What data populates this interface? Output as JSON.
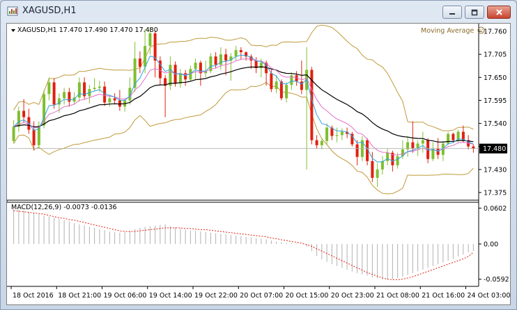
{
  "window": {
    "title": "XAGUSD,H1",
    "icon": "chart-window-icon",
    "controls": [
      "minimize-icon",
      "maximize-icon",
      "close-icon"
    ]
  },
  "chart_header": {
    "symbol": "XAGUSD,H1",
    "ohlc": "17.470 17.490 17.470 17.480",
    "indicator": "Moving Average"
  },
  "macd_header": {
    "label": "MACD(12,26,9)",
    "values": "-0.0073 -0.0136"
  },
  "price_axis": {
    "ticks": [
      "17.760",
      "17.705",
      "17.650",
      "17.595",
      "17.540",
      "17.485",
      "17.430",
      "17.375"
    ],
    "current_price": "17.480",
    "current_price_color": "#000000"
  },
  "macd_axis": {
    "ticks": [
      "0.0602",
      "0.00",
      "-0.0592"
    ]
  },
  "time_axis": {
    "ticks": [
      "18 Oct 2016",
      "18 Oct 21:00",
      "19 Oct 06:00",
      "19 Oct 14:00",
      "19 Oct 22:00",
      "20 Oct 07:00",
      "20 Oct 15:00",
      "20 Oct 23:00",
      "21 Oct 08:00",
      "21 Oct 16:00",
      "24 Oct 03:00"
    ]
  },
  "colors": {
    "bull": "#7fbf30",
    "bear": "#e02010",
    "bands": "#c09a3a",
    "ma_slow": "#000000",
    "ma_fast": "#2ca0e0",
    "ma_mid": "#e070c8",
    "signal": "#e02010",
    "histogram": "#b0b0b0"
  },
  "chart_data": {
    "type": "candlestick",
    "y_range": [
      17.36,
      17.775
    ],
    "macd_range": [
      -0.07,
      0.07
    ],
    "candles": [
      [
        17.498,
        17.548,
        17.492,
        17.532
      ],
      [
        17.532,
        17.58,
        17.52,
        17.57
      ],
      [
        17.57,
        17.598,
        17.542,
        17.555
      ],
      [
        17.555,
        17.575,
        17.515,
        17.525
      ],
      [
        17.525,
        17.545,
        17.475,
        17.488
      ],
      [
        17.488,
        17.545,
        17.48,
        17.535
      ],
      [
        17.535,
        17.62,
        17.528,
        17.61
      ],
      [
        17.61,
        17.65,
        17.595,
        17.638
      ],
      [
        17.638,
        17.648,
        17.575,
        17.585
      ],
      [
        17.585,
        17.612,
        17.565,
        17.6
      ],
      [
        17.6,
        17.625,
        17.585,
        17.615
      ],
      [
        17.615,
        17.625,
        17.58,
        17.592
      ],
      [
        17.592,
        17.615,
        17.585,
        17.602
      ],
      [
        17.602,
        17.65,
        17.592,
        17.638
      ],
      [
        17.638,
        17.65,
        17.598,
        17.605
      ],
      [
        17.605,
        17.632,
        17.588,
        17.622
      ],
      [
        17.622,
        17.648,
        17.618,
        17.625
      ],
      [
        17.625,
        17.642,
        17.615,
        17.628
      ],
      [
        17.628,
        17.64,
        17.582,
        17.59
      ],
      [
        17.59,
        17.608,
        17.58,
        17.6
      ],
      [
        17.6,
        17.612,
        17.585,
        17.595
      ],
      [
        17.595,
        17.62,
        17.57,
        17.58
      ],
      [
        17.58,
        17.598,
        17.568,
        17.595
      ],
      [
        17.595,
        17.65,
        17.585,
        17.625
      ],
      [
        17.625,
        17.735,
        17.615,
        17.695
      ],
      [
        17.695,
        17.712,
        17.66,
        17.675
      ],
      [
        17.675,
        17.765,
        17.66,
        17.725
      ],
      [
        17.725,
        17.77,
        17.705,
        17.755
      ],
      [
        17.755,
        17.762,
        17.65,
        17.69
      ],
      [
        17.69,
        17.7,
        17.632,
        17.648
      ],
      [
        17.648,
        17.655,
        17.555,
        17.63
      ],
      [
        17.63,
        17.7,
        17.62,
        17.68
      ],
      [
        17.68,
        17.688,
        17.628,
        17.635
      ],
      [
        17.635,
        17.67,
        17.625,
        17.66
      ],
      [
        17.66,
        17.668,
        17.63,
        17.645
      ],
      [
        17.645,
        17.678,
        17.64,
        17.67
      ],
      [
        17.67,
        17.695,
        17.645,
        17.685
      ],
      [
        17.685,
        17.69,
        17.63,
        17.66
      ],
      [
        17.66,
        17.69,
        17.65,
        17.665
      ],
      [
        17.665,
        17.708,
        17.66,
        17.7
      ],
      [
        17.7,
        17.71,
        17.672,
        17.68
      ],
      [
        17.68,
        17.722,
        17.668,
        17.705
      ],
      [
        17.705,
        17.718,
        17.655,
        17.69
      ],
      [
        17.69,
        17.708,
        17.642,
        17.7
      ],
      [
        17.7,
        17.725,
        17.69,
        17.715
      ],
      [
        17.715,
        17.722,
        17.692,
        17.71
      ],
      [
        17.71,
        17.712,
        17.69,
        17.7
      ],
      [
        17.7,
        17.705,
        17.67,
        17.69
      ],
      [
        17.69,
        17.698,
        17.66,
        17.672
      ],
      [
        17.672,
        17.695,
        17.65,
        17.685
      ],
      [
        17.685,
        17.69,
        17.63,
        17.66
      ],
      [
        17.66,
        17.668,
        17.615,
        17.622
      ],
      [
        17.622,
        17.655,
        17.612,
        17.64
      ],
      [
        17.64,
        17.645,
        17.595,
        17.6
      ],
      [
        17.6,
        17.638,
        17.59,
        17.632
      ],
      [
        17.632,
        17.662,
        17.62,
        17.655
      ],
      [
        17.655,
        17.665,
        17.63,
        17.64
      ],
      [
        17.64,
        17.69,
        17.61,
        17.62
      ],
      [
        17.62,
        17.722,
        17.43,
        17.668
      ],
      [
        17.668,
        17.675,
        17.49,
        17.5
      ],
      [
        17.5,
        17.512,
        17.48,
        17.488
      ],
      [
        17.488,
        17.505,
        17.478,
        17.498
      ],
      [
        17.498,
        17.54,
        17.49,
        17.53
      ],
      [
        17.53,
        17.535,
        17.5,
        17.51
      ],
      [
        17.51,
        17.53,
        17.495,
        17.512
      ],
      [
        17.512,
        17.528,
        17.5,
        17.52
      ],
      [
        17.52,
        17.53,
        17.505,
        17.515
      ],
      [
        17.515,
        17.52,
        17.485,
        17.49
      ],
      [
        17.49,
        17.5,
        17.44,
        17.46
      ],
      [
        17.46,
        17.51,
        17.45,
        17.5
      ],
      [
        17.5,
        17.505,
        17.44,
        17.45
      ],
      [
        17.45,
        17.472,
        17.4,
        17.41
      ],
      [
        17.41,
        17.445,
        17.388,
        17.43
      ],
      [
        17.43,
        17.462,
        17.418,
        17.45
      ],
      [
        17.45,
        17.48,
        17.44,
        17.47
      ],
      [
        17.47,
        17.475,
        17.425,
        17.44
      ],
      [
        17.44,
        17.47,
        17.432,
        17.462
      ],
      [
        17.462,
        17.5,
        17.455,
        17.478
      ],
      [
        17.478,
        17.51,
        17.46,
        17.495
      ],
      [
        17.495,
        17.545,
        17.47,
        17.48
      ],
      [
        17.48,
        17.5,
        17.462,
        17.492
      ],
      [
        17.492,
        17.52,
        17.47,
        17.5
      ],
      [
        17.5,
        17.505,
        17.445,
        17.455
      ],
      [
        17.455,
        17.495,
        17.45,
        17.48
      ],
      [
        17.48,
        17.505,
        17.455,
        17.465
      ],
      [
        17.465,
        17.498,
        17.45,
        17.492
      ],
      [
        17.492,
        17.52,
        17.488,
        17.515
      ],
      [
        17.515,
        17.518,
        17.495,
        17.5
      ],
      [
        17.5,
        17.525,
        17.495,
        17.52
      ],
      [
        17.52,
        17.535,
        17.495,
        17.5
      ],
      [
        17.5,
        17.512,
        17.478,
        17.485
      ],
      [
        17.485,
        17.49,
        17.47,
        17.48
      ]
    ],
    "macd_histogram": [
      0.06,
      0.058,
      0.056,
      0.054,
      0.052,
      0.05,
      0.048,
      0.046,
      0.044,
      0.042,
      0.04,
      0.038,
      0.035,
      0.033,
      0.031,
      0.029,
      0.027,
      0.025,
      0.023,
      0.021,
      0.02,
      0.019,
      0.02,
      0.022,
      0.025,
      0.027,
      0.029,
      0.03,
      0.031,
      0.032,
      0.033,
      0.03,
      0.028,
      0.026,
      0.024,
      0.023,
      0.022,
      0.021,
      0.02,
      0.019,
      0.018,
      0.017,
      0.016,
      0.015,
      0.014,
      0.013,
      0.012,
      0.011,
      0.01,
      0.009,
      0.008,
      0.006,
      0.004,
      0.003,
      0.002,
      0.001,
      0.001,
      0.0,
      -0.004,
      -0.012,
      -0.02,
      -0.026,
      -0.03,
      -0.034,
      -0.037,
      -0.04,
      -0.043,
      -0.046,
      -0.049,
      -0.051,
      -0.053,
      -0.056,
      -0.058,
      -0.059,
      -0.06,
      -0.059,
      -0.057,
      -0.055,
      -0.052,
      -0.049,
      -0.046,
      -0.043,
      -0.04,
      -0.037,
      -0.034,
      -0.031,
      -0.028,
      -0.025,
      -0.021,
      -0.018,
      -0.014,
      -0.012
    ],
    "macd_signal": [
      0.056,
      0.055,
      0.054,
      0.053,
      0.052,
      0.051,
      0.05,
      0.048,
      0.046,
      0.044,
      0.043,
      0.041,
      0.04,
      0.038,
      0.036,
      0.034,
      0.032,
      0.03,
      0.028,
      0.026,
      0.024,
      0.022,
      0.021,
      0.021,
      0.021,
      0.022,
      0.023,
      0.024,
      0.025,
      0.026,
      0.027,
      0.027,
      0.027,
      0.027,
      0.026,
      0.026,
      0.025,
      0.024,
      0.024,
      0.023,
      0.022,
      0.021,
      0.02,
      0.019,
      0.018,
      0.017,
      0.016,
      0.015,
      0.014,
      0.013,
      0.012,
      0.01,
      0.009,
      0.007,
      0.006,
      0.004,
      0.003,
      0.001,
      -0.001,
      -0.004,
      -0.008,
      -0.012,
      -0.016,
      -0.02,
      -0.024,
      -0.028,
      -0.032,
      -0.036,
      -0.04,
      -0.044,
      -0.048,
      -0.051,
      -0.054,
      -0.057,
      -0.059,
      -0.06,
      -0.06,
      -0.059,
      -0.057,
      -0.055,
      -0.052,
      -0.049,
      -0.046,
      -0.043,
      -0.04,
      -0.037,
      -0.034,
      -0.031,
      -0.028,
      -0.025,
      -0.021,
      -0.0136
    ]
  }
}
